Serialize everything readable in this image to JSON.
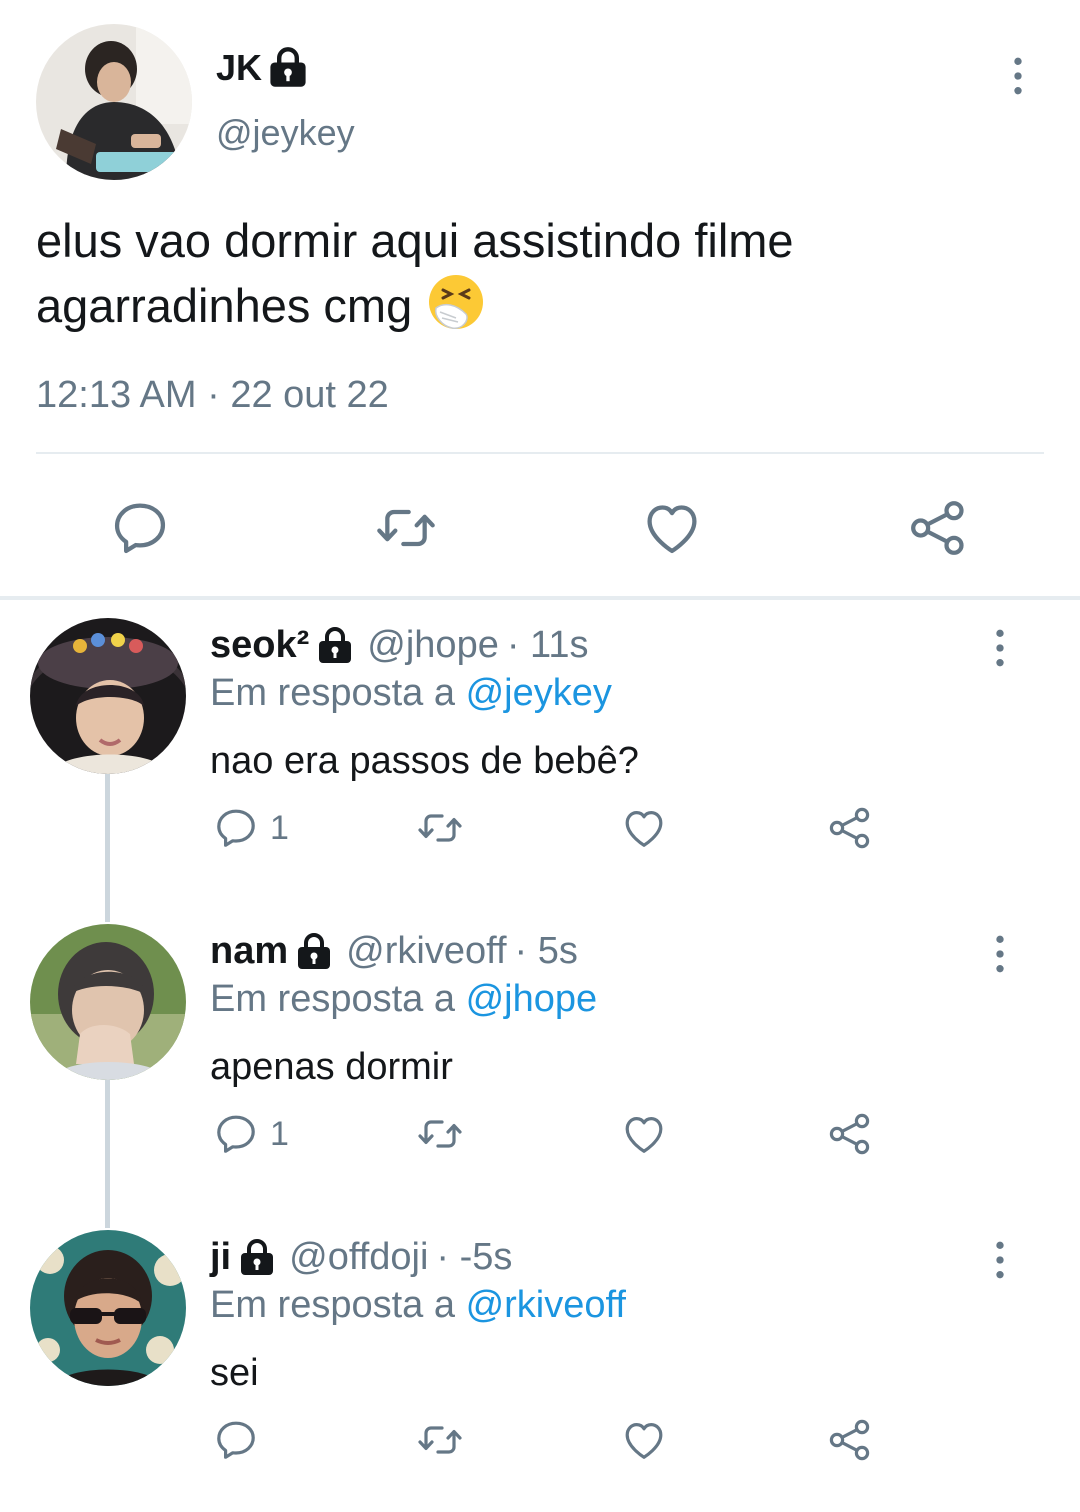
{
  "main_tweet": {
    "name": "JK",
    "handle": "@jeykey",
    "text": "elus vao dormir aqui assistindo filme agarradinhes cmg",
    "emoji": "sneezing-face-emoji",
    "timestamp": "12:13 AM · 22 out 22"
  },
  "replies": [
    {
      "name": "seok²",
      "handle": "@jhope",
      "time": "· 11s",
      "replying_prefix": "Em resposta a",
      "replying_to": "@jeykey",
      "text": "nao era passos de bebê?",
      "reply_count": "1"
    },
    {
      "name": "nam",
      "handle": "@rkiveoff",
      "time": "· 5s",
      "replying_prefix": "Em resposta a",
      "replying_to": "@jhope",
      "text": "apenas dormir",
      "reply_count": "1"
    },
    {
      "name": "ji",
      "handle": "@offdoji",
      "time": "· -5s",
      "replying_prefix": "Em resposta a",
      "replying_to": "@rkiveoff",
      "text": "sei",
      "reply_count": ""
    }
  ],
  "colors": {
    "text": "#14171a",
    "secondary": "#657786",
    "link": "#1b95e0",
    "divider": "#e6ecf0"
  },
  "icons": [
    "lock-icon",
    "more-vertical-icon",
    "reply-icon",
    "retweet-icon",
    "like-icon",
    "share-icon"
  ]
}
